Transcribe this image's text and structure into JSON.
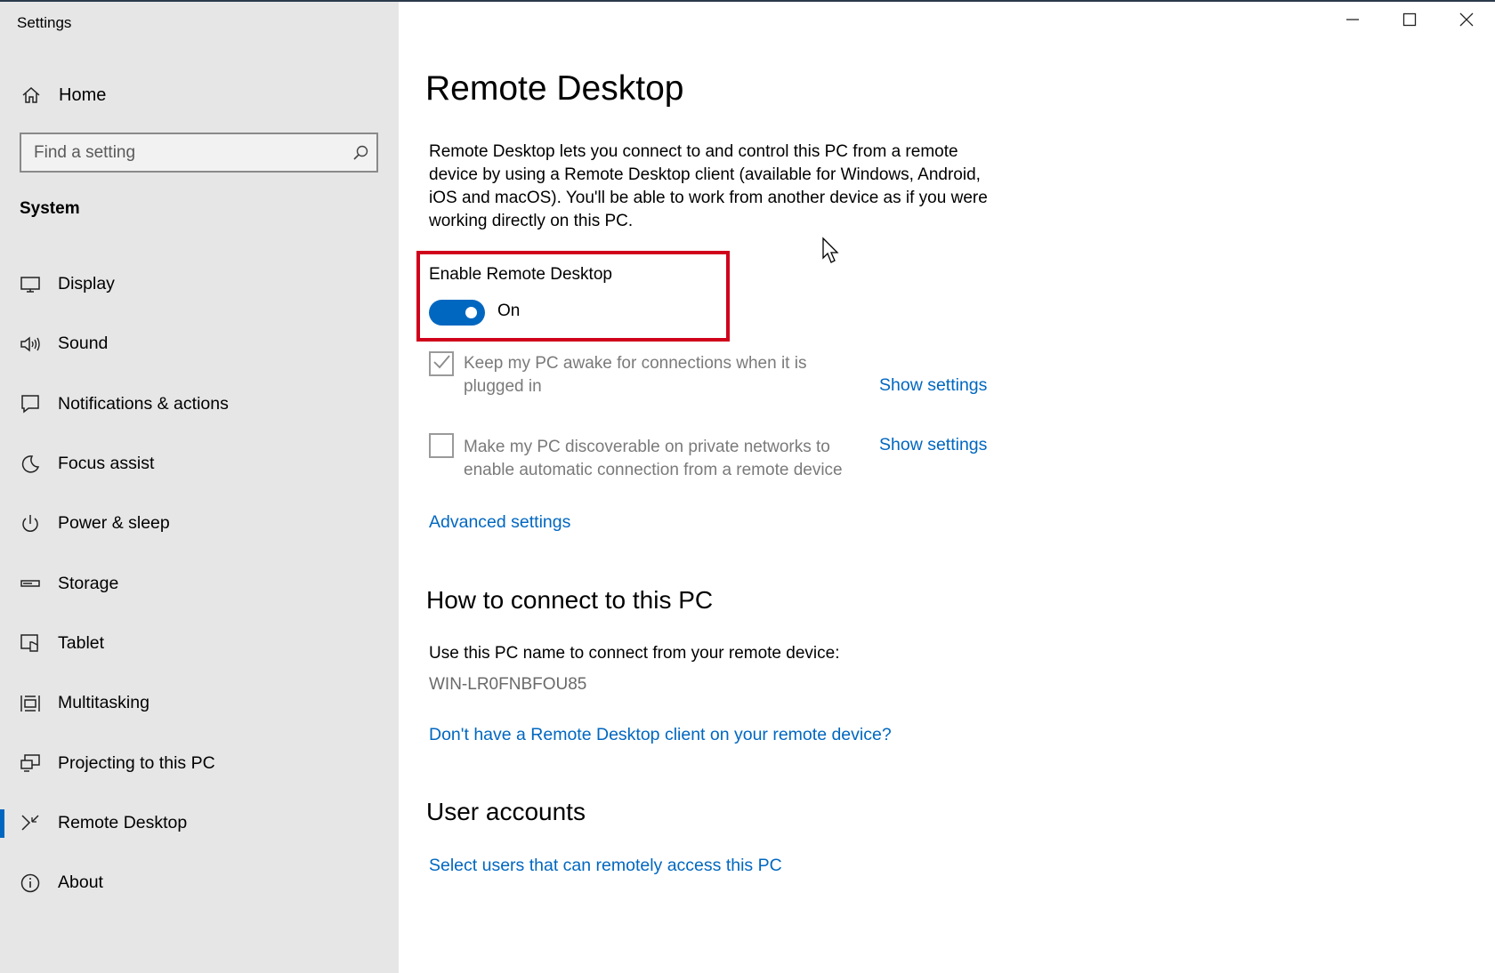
{
  "window": {
    "title": "Settings",
    "minimize_icon": "minimize-icon",
    "maximize_icon": "maximize-icon",
    "close_icon": "close-icon"
  },
  "sidebar": {
    "home_label": "Home",
    "search_placeholder": "Find a setting",
    "section": "System",
    "items": [
      {
        "label": "Display",
        "icon": "monitor-icon"
      },
      {
        "label": "Sound",
        "icon": "speaker-icon"
      },
      {
        "label": "Notifications & actions",
        "icon": "notification-icon"
      },
      {
        "label": "Focus assist",
        "icon": "moon-icon"
      },
      {
        "label": "Power & sleep",
        "icon": "power-icon"
      },
      {
        "label": "Storage",
        "icon": "storage-icon"
      },
      {
        "label": "Tablet",
        "icon": "tablet-icon"
      },
      {
        "label": "Multitasking",
        "icon": "multitasking-icon"
      },
      {
        "label": "Projecting to this PC",
        "icon": "projecting-icon"
      },
      {
        "label": "Remote Desktop",
        "icon": "remote-desktop-icon",
        "active": true
      },
      {
        "label": "About",
        "icon": "info-icon"
      }
    ]
  },
  "main": {
    "title": "Remote Desktop",
    "description": "Remote Desktop lets you connect to and control this PC from a remote device by using a Remote Desktop client (available for Windows, Android, iOS and macOS). You'll be able to work from another device as if you were working directly on this PC.",
    "enable_label": "Enable Remote Desktop",
    "toggle_state": "On",
    "toggle_on": true,
    "keep_awake": {
      "text": "Keep my PC awake for connections when it is plugged in",
      "checked": true,
      "link": "Show settings"
    },
    "discoverable": {
      "text": "Make my PC discoverable on private networks to enable automatic connection from a remote device",
      "checked": false,
      "link": "Show settings"
    },
    "advanced_link": "Advanced settings",
    "connect_heading": "How to connect to this PC",
    "connect_text": "Use this PC name to connect from your remote device:",
    "pc_name": "WIN-LR0FNBFOU85",
    "client_link": "Don't have a Remote Desktop client on your remote device?",
    "accounts_heading": "User accounts",
    "accounts_link": "Select users that can remotely access this PC"
  },
  "colors": {
    "accent": "#0067c0",
    "highlight": "#d0021b",
    "sidebar_bg": "#e6e6e6"
  }
}
